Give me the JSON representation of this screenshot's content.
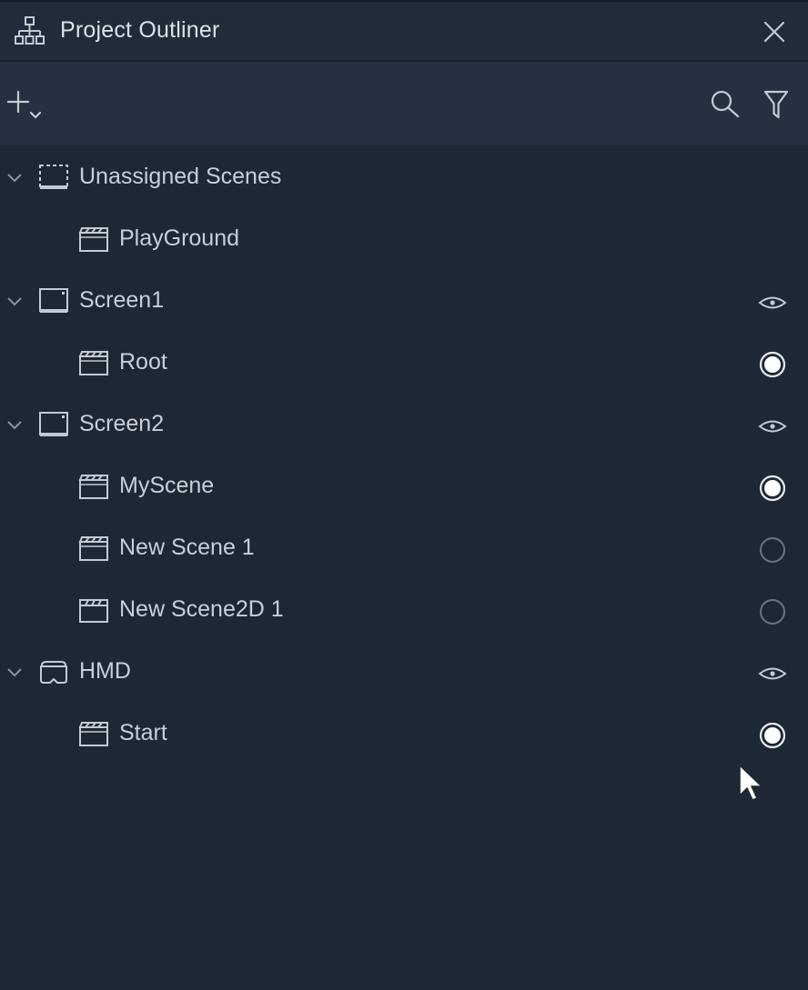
{
  "window": {
    "title": "Project Outliner",
    "title_icon": "hierarchy-icon",
    "close_icon": "close-icon"
  },
  "toolbar": {
    "add_icon": "plus-dropdown-icon",
    "search_icon": "search-icon",
    "filter_icon": "filter-icon"
  },
  "tree": [
    {
      "label": "Unassigned Scenes",
      "kind": "group",
      "icon": "dashed-screen-icon",
      "control": "none"
    },
    {
      "label": "PlayGround",
      "kind": "scene",
      "icon": "clapperboard-3d-icon",
      "control": "none"
    },
    {
      "label": "Screen1",
      "kind": "group",
      "icon": "screen-icon",
      "control": "eye"
    },
    {
      "label": "Root",
      "kind": "scene",
      "icon": "clapperboard-3d-icon",
      "control": "radio-on"
    },
    {
      "label": "Screen2",
      "kind": "group",
      "icon": "screen-icon",
      "control": "eye"
    },
    {
      "label": "MyScene",
      "kind": "scene",
      "icon": "clapperboard-3d-icon",
      "control": "radio-on"
    },
    {
      "label": "New Scene 1",
      "kind": "scene",
      "icon": "clapperboard-3d-icon",
      "control": "radio-off"
    },
    {
      "label": "New Scene2D 1",
      "kind": "scene",
      "icon": "clapperboard-2d-icon",
      "control": "radio-off"
    },
    {
      "label": "HMD",
      "kind": "group",
      "icon": "vr-headset-icon",
      "control": "eye"
    },
    {
      "label": "Start",
      "kind": "scene",
      "icon": "clapperboard-3d-icon",
      "control": "radio-on"
    }
  ],
  "colors": {
    "background": "#1e2734",
    "titlebar": "#212b39",
    "toolbar": "#253040",
    "text": "#c9cfd8",
    "icon": "#c4cad3"
  }
}
